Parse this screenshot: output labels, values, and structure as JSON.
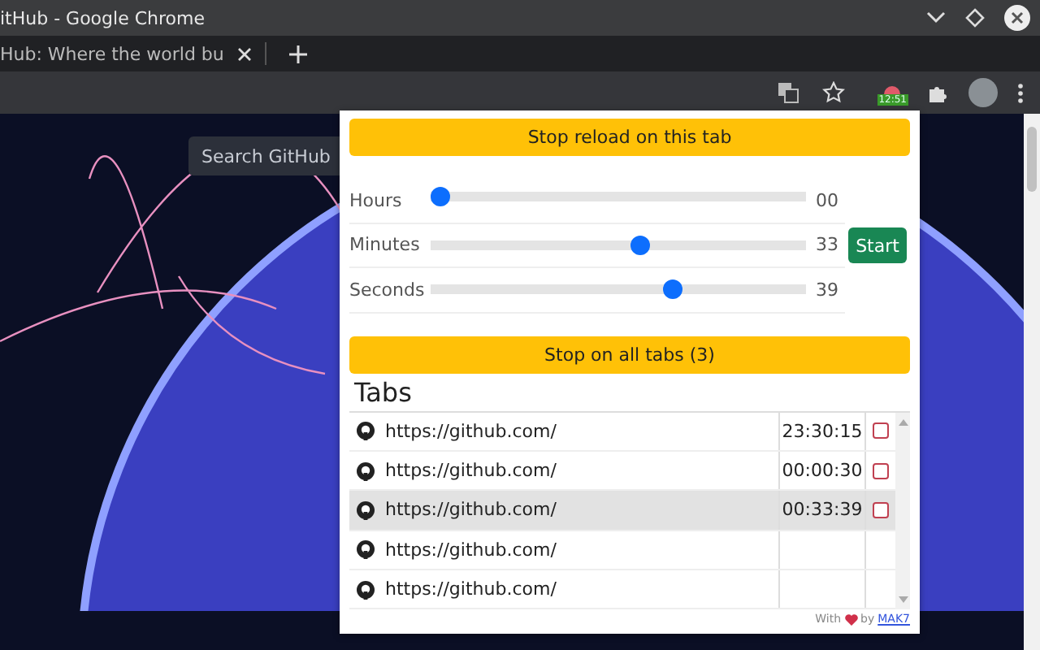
{
  "window": {
    "title": "itHub - Google Chrome"
  },
  "browser_tab": {
    "title": "Hub: Where the world bu"
  },
  "extension_badge": "12:51",
  "page": {
    "search": {
      "placeholder": "Search GitHub"
    }
  },
  "popup": {
    "stop_tab_button": "Stop reload on this tab",
    "timers": [
      {
        "label": "Hours",
        "level": 0,
        "reading": "00"
      },
      {
        "label": "Minutes",
        "level": 0.56,
        "reading": "33"
      },
      {
        "label": "Seconds",
        "level": 0.655,
        "reading": "39"
      }
    ],
    "start_button": "Start",
    "stop_all_button": "Stop on all tabs (3)",
    "tabs_heading": "Tabs",
    "tabs": [
      {
        "url": "https://github.com/",
        "time": "23:30:15",
        "checked": false,
        "selected": false
      },
      {
        "url": "https://github.com/",
        "time": "00:00:30",
        "checked": false,
        "selected": false
      },
      {
        "url": "https://github.com/",
        "time": "00:33:39",
        "checked": false,
        "selected": true
      },
      {
        "url": "https://github.com/",
        "selected": false
      },
      {
        "url": "https://github.com/",
        "selected": false
      }
    ],
    "footer": {
      "prefix": "With",
      "suffix": "by",
      "link": "MAK7"
    }
  }
}
